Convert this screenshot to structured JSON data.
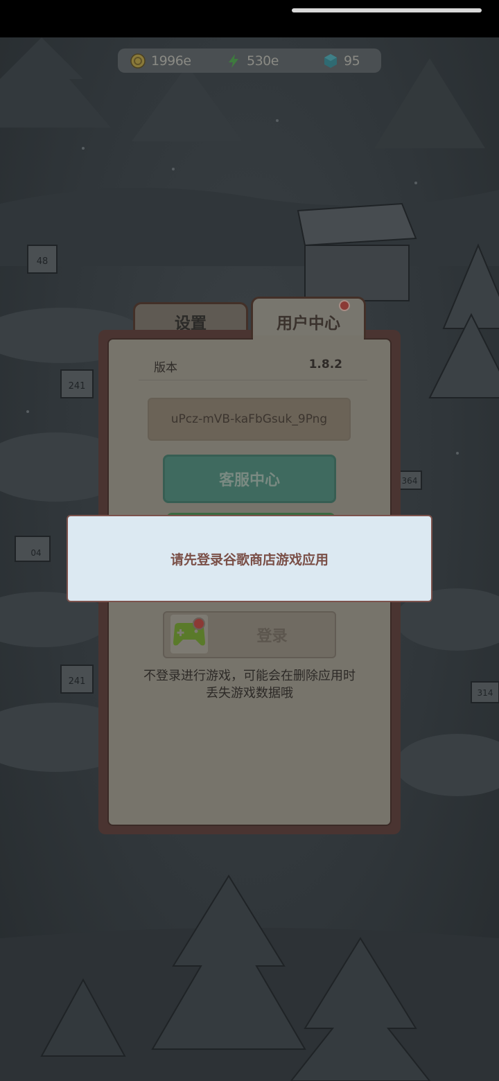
{
  "resources": {
    "coins": "1996e",
    "energy": "530e",
    "gems": "95"
  },
  "tabs": {
    "settings": "设置",
    "user_center": "用户中心"
  },
  "user_center": {
    "version_label": "版本",
    "version_value": "1.8.2",
    "user_id": "uPcz-mVB-kaFbGsuk_9Png",
    "support_button": "客服中心",
    "login_button": "登录",
    "warning_text": "不登录进行游戏，可能会在删除应用时",
    "warning_text_2": "丢失游戏数据哦"
  },
  "toast": {
    "message": "请先登录谷歌商店游戏应用"
  },
  "scene_labels": {
    "sign_48": "48",
    "sign_241a": "241",
    "sign_241b": "241",
    "sign_364": "364",
    "sign_314": "314",
    "crate_04": "04"
  },
  "colors": {
    "toast_bg": "#dce9f2",
    "toast_text": "#7a4f47",
    "support_button": "#3f6a5f",
    "panel_frame": "#4a3431"
  }
}
